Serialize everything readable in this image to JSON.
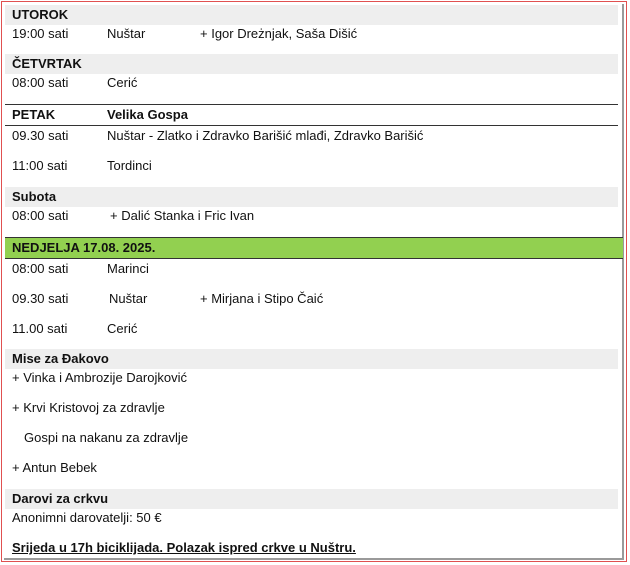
{
  "sections": {
    "utorak": {
      "header": "UTOROK",
      "rows": [
        {
          "time": "19:00 sati",
          "place": "Nuštar",
          "intention": "+ Igor Dreżnjak, Saša Dišić"
        }
      ]
    },
    "cetvrtak": {
      "header": "ČETVRTAK",
      "rows": [
        {
          "time": "08:00 sati",
          "place": "Cerić"
        }
      ]
    },
    "petak": {
      "header": "PETAK",
      "header_note": "Velika Gospa",
      "rows": [
        {
          "time": "09.30 sati",
          "place": "Nuštar - Zlatko i Zdravko Barišić mlađi, Zdravko Barišić"
        },
        {
          "time": "11:00 sati",
          "place": "Tordinci"
        }
      ]
    },
    "subota": {
      "header": "Subota",
      "rows": [
        {
          "time": "08:00 sati",
          "intention": "+ Dalić Stanka i Fric Ivan"
        }
      ]
    },
    "nedjelja": {
      "header": "NEDJELJA 17.08. 2025.",
      "rows": [
        {
          "time": "08:00 sati",
          "place": "Marinci"
        },
        {
          "time": "09.30 sati",
          "place": "Nuštar",
          "intention": "+ Mirjana i Stipo Čaić"
        },
        {
          "time": "11.00 sati",
          "place": "Cerić"
        }
      ]
    },
    "mise_djakovo": {
      "header": "Mise za Đakovo",
      "items": [
        "+ Vinka i Ambrozije Darojković",
        "+ Krvi Kristovoj za zdravlje",
        "Gospi na nakanu za zdravlje",
        "+ Antun Bebek"
      ]
    },
    "darovi": {
      "header": "Darovi za crkvu",
      "items": [
        "Anonimni darovatelji: 50 €"
      ]
    }
  },
  "announcement": "Srijeda u 17h biciklijada. Polazak ispred crkve u Nuštru."
}
